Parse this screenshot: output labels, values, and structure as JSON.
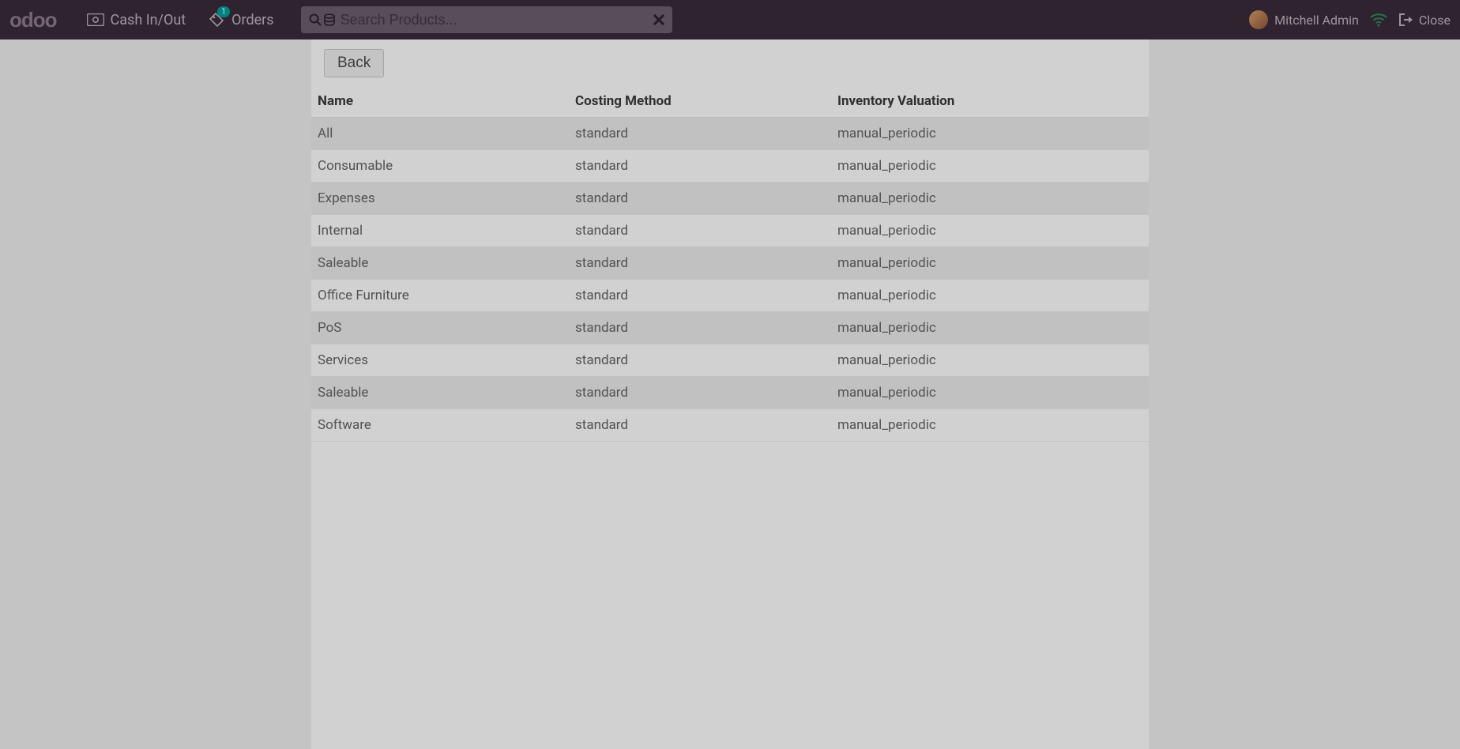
{
  "brand": "odoo",
  "topbar": {
    "cash_label": "Cash In/Out",
    "orders_label": "Orders",
    "orders_badge": "1",
    "search_placeholder": "Search Products...",
    "user_name": "Mitchell Admin",
    "close_label": "Close"
  },
  "buttons": {
    "back": "Back"
  },
  "table": {
    "headers": {
      "name": "Name",
      "costing": "Costing Method",
      "valuation": "Inventory Valuation"
    },
    "rows": [
      {
        "name": "All",
        "costing": "standard",
        "valuation": "manual_periodic"
      },
      {
        "name": "Consumable",
        "costing": "standard",
        "valuation": "manual_periodic"
      },
      {
        "name": "Expenses",
        "costing": "standard",
        "valuation": "manual_periodic"
      },
      {
        "name": "Internal",
        "costing": "standard",
        "valuation": "manual_periodic"
      },
      {
        "name": "Saleable",
        "costing": "standard",
        "valuation": "manual_periodic"
      },
      {
        "name": "Office Furniture",
        "costing": "standard",
        "valuation": "manual_periodic"
      },
      {
        "name": "PoS",
        "costing": "standard",
        "valuation": "manual_periodic"
      },
      {
        "name": "Services",
        "costing": "standard",
        "valuation": "manual_periodic"
      },
      {
        "name": "Saleable",
        "costing": "standard",
        "valuation": "manual_periodic"
      },
      {
        "name": "Software",
        "costing": "standard",
        "valuation": "manual_periodic"
      }
    ]
  }
}
